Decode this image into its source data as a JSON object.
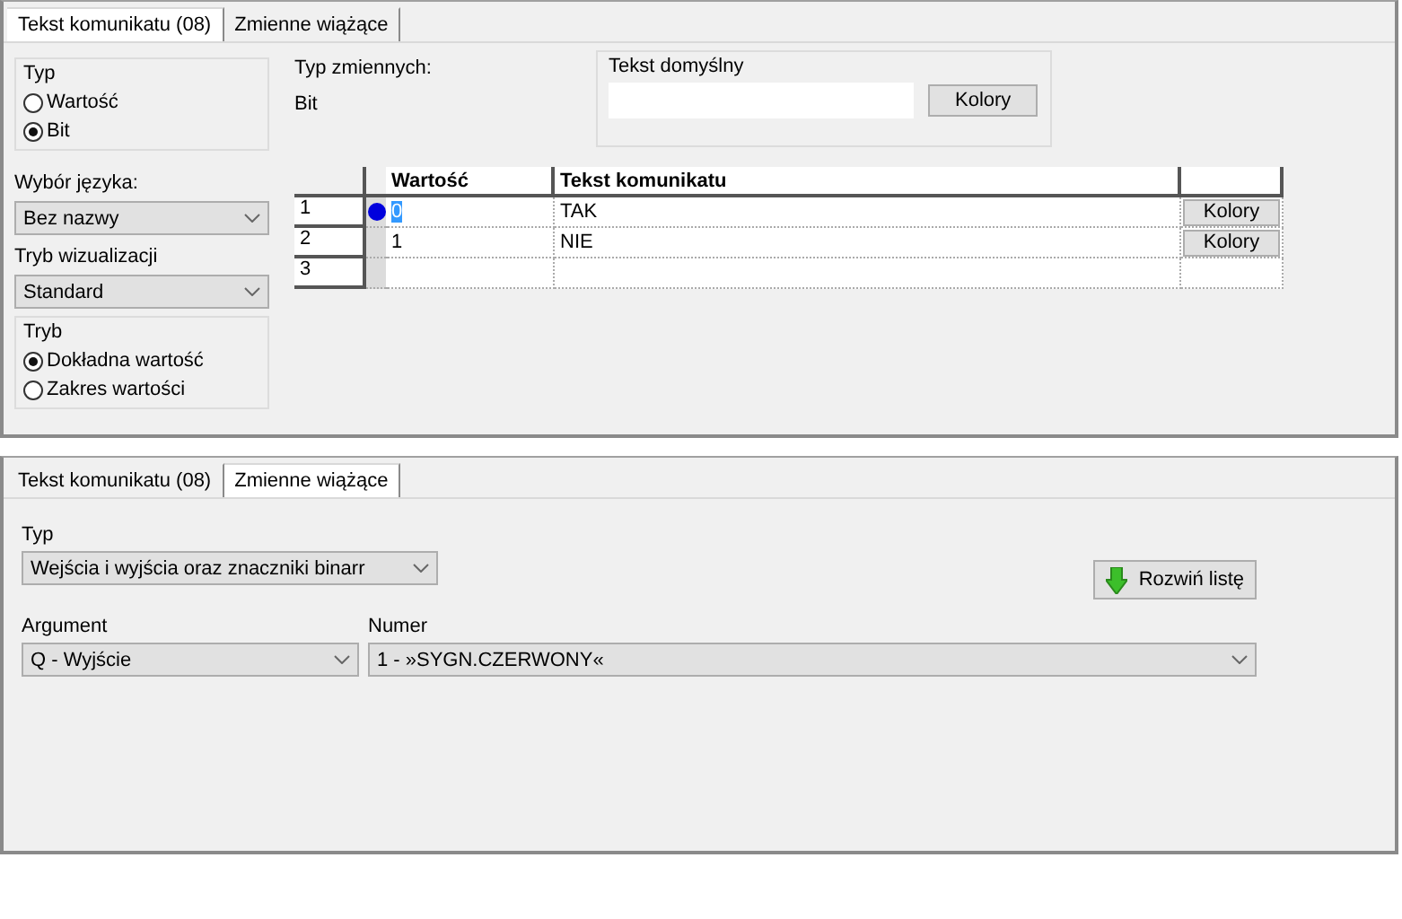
{
  "message_panel": {
    "tabs": [
      {
        "label": "Tekst komunikatu (08)",
        "selected": true
      },
      {
        "label": "Zmienne wiążące",
        "selected": false
      }
    ],
    "type_group": {
      "title": "Typ",
      "options": [
        {
          "label": "Wartość",
          "selected": false
        },
        {
          "label": "Bit",
          "selected": true
        }
      ]
    },
    "language": {
      "label": "Wybór języka:",
      "value": "Bez nazwy"
    },
    "visualization": {
      "label": "Tryb wizualizacji",
      "value": "Standard"
    },
    "mode_group": {
      "title": "Tryb",
      "options": [
        {
          "label": "Dokładna wartość",
          "selected": true
        },
        {
          "label": "Zakres wartości",
          "selected": false
        }
      ]
    },
    "variable_type": {
      "label": "Typ zmiennych:",
      "value": "Bit"
    },
    "default_text": {
      "title": "Tekst domyślny",
      "button": "Kolory"
    },
    "table": {
      "columns": [
        "Wartość",
        "Tekst komunikatu"
      ],
      "rows": [
        {
          "number": "1",
          "value": "0",
          "text": "TAK",
          "current": true,
          "button": "Kolory"
        },
        {
          "number": "2",
          "value": "1",
          "text": "NIE",
          "current": false,
          "button": "Kolory"
        },
        {
          "number": "3",
          "current": false
        }
      ]
    }
  },
  "binding_panel": {
    "tabs": [
      {
        "label": "Tekst komunikatu (08)",
        "selected": false
      },
      {
        "label": "Zmienne wiążące",
        "selected": true
      }
    ],
    "type": {
      "label": "Typ",
      "value": "Wejścia i wyjścia oraz znaczniki binarr"
    },
    "expand_button": "Rozwiń listę",
    "argument": {
      "label": "Argument",
      "value": "Q - Wyjście"
    },
    "number": {
      "label": "Numer",
      "value": "1 - »SYGN.CZERWONY«"
    }
  }
}
